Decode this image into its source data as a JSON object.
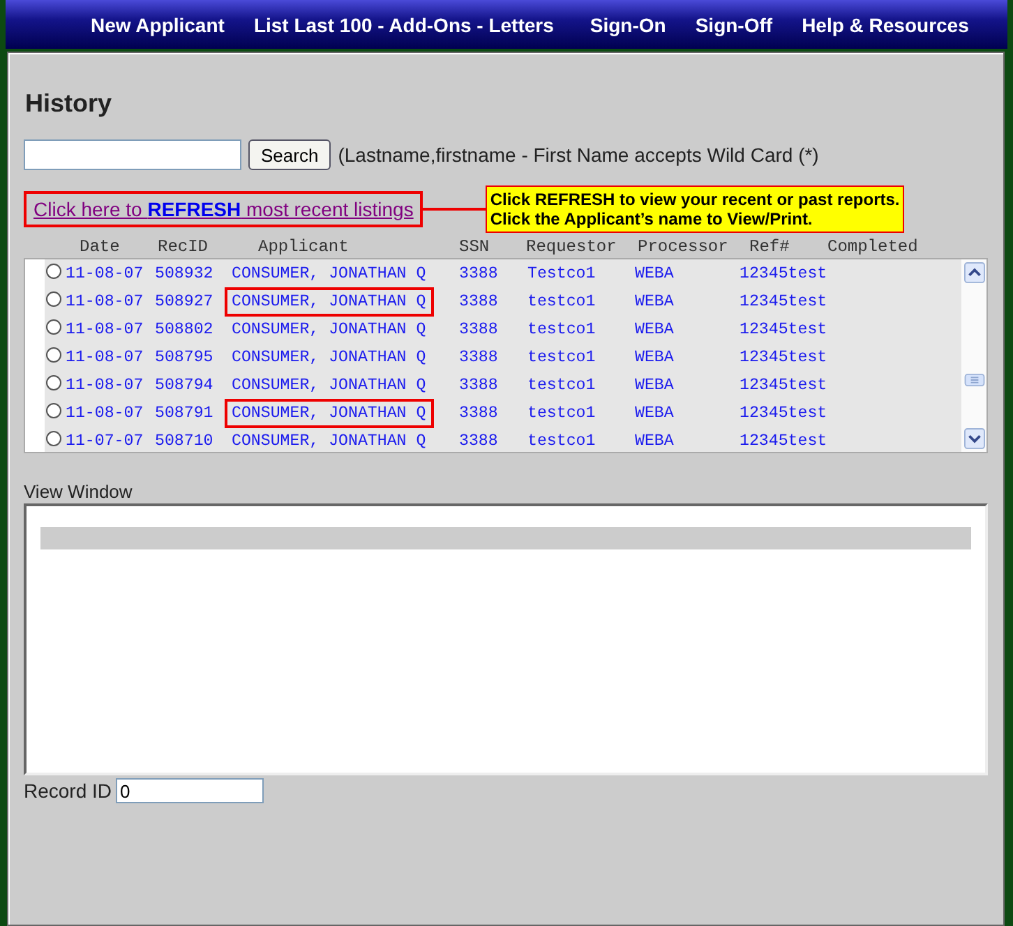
{
  "nav": [
    {
      "label": "New Applicant"
    },
    {
      "label": "List Last 100 - Add-Ons - Letters"
    },
    {
      "label": "Sign-On"
    },
    {
      "label": "Sign-Off"
    },
    {
      "label": "Help & Resources"
    }
  ],
  "title": "History",
  "search": {
    "button": "Search",
    "hint": "(Lastname,firstname - First Name accepts Wild Card (*)"
  },
  "refresh_link": {
    "text": "Click here to **REFRESH** most recent listings",
    "outlined": true
  },
  "callout": [
    "Click REFRESH to view your recent or past reports.",
    "Click the Applicant’s name to View/Print."
  ],
  "table": {
    "columns": [
      "Date",
      "RecID",
      "Applicant",
      "SSN",
      "Requestor",
      "Processor",
      "Ref#",
      "Completed"
    ],
    "rows": [
      {
        "selected": false,
        "outlined": false,
        "cells": [
          "11-08-07",
          "508932",
          "CONSUMER, JONATHAN Q",
          "3388",
          "Testco1",
          "WEBA",
          "12345test"
        ]
      },
      {
        "selected": false,
        "outlined": true,
        "cells": [
          "11-08-07",
          "508927",
          "CONSUMER, JONATHAN Q",
          "3388",
          "testco1",
          "WEBA",
          "12345test"
        ]
      },
      {
        "selected": false,
        "outlined": false,
        "cells": [
          "11-08-07",
          "508802",
          "CONSUMER, JONATHAN Q",
          "3388",
          "testco1",
          "WEBA",
          "12345test"
        ]
      },
      {
        "selected": false,
        "outlined": false,
        "cells": [
          "11-08-07",
          "508795",
          "CONSUMER, JONATHAN Q",
          "3388",
          "testco1",
          "WEBA",
          "12345test"
        ]
      },
      {
        "selected": false,
        "outlined": false,
        "cells": [
          "11-08-07",
          "508794",
          "CONSUMER, JONATHAN Q",
          "3388",
          "testco1",
          "WEBA",
          "12345test"
        ]
      },
      {
        "selected": false,
        "outlined": true,
        "cells": [
          "11-08-07",
          "508791",
          "CONSUMER, JONATHAN Q",
          "3388",
          "testco1",
          "WEBA",
          "12345test"
        ]
      },
      {
        "selected": false,
        "outlined": false,
        "cells": [
          "11-07-07",
          "508710",
          "CONSUMER, JONATHAN Q",
          "3388",
          "testco1",
          "WEBA",
          "12345test"
        ]
      }
    ]
  },
  "view_window": {
    "label": "View Window"
  },
  "record_id": {
    "label": "Record ID",
    "value": "0"
  }
}
